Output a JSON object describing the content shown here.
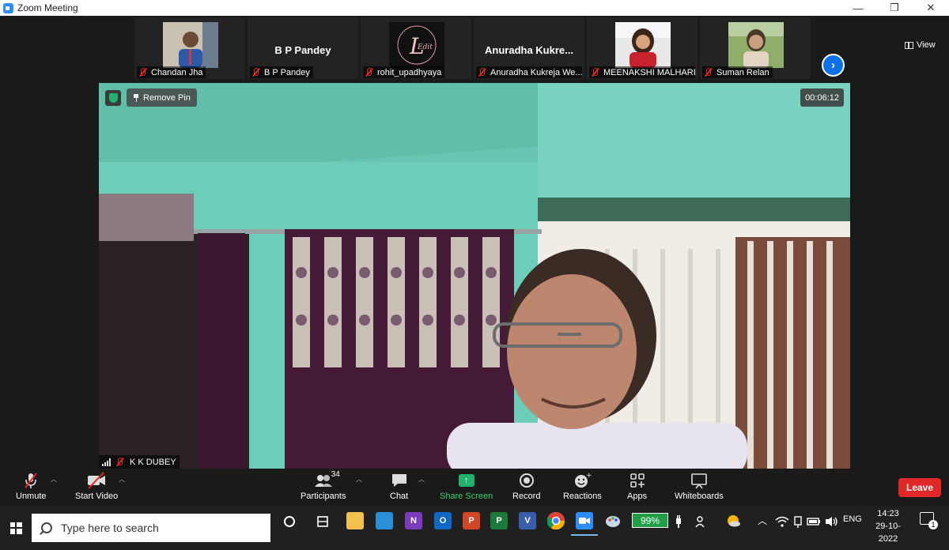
{
  "window": {
    "title": "Zoom Meeting",
    "controls": [
      "—",
      "❐",
      "✕"
    ]
  },
  "thumbnails": [
    {
      "label": "Chandan Jha",
      "big_name": "",
      "has_video": true
    },
    {
      "label": "B P Pandey",
      "big_name": "B P Pandey",
      "has_video": false
    },
    {
      "label": "rohit_upadhyaya",
      "big_name": "",
      "has_video": true
    },
    {
      "label": "Anuradha Kukreja We...",
      "big_name": "Anuradha  Kukre...",
      "has_video": false
    },
    {
      "label": "MEENAKSHI MALHARI",
      "big_name": "",
      "has_video": true
    },
    {
      "label": "Suman Relan",
      "big_name": "",
      "has_video": true
    }
  ],
  "view_button": {
    "label": "View"
  },
  "main_video": {
    "remove_pin_label": "Remove Pin",
    "timer": "00:06:12",
    "speaker_name": "K K DUBEY"
  },
  "controls": {
    "unmute": "Unmute",
    "start_video": "Start Video",
    "participants": "Participants",
    "participants_count": "34",
    "chat": "Chat",
    "share_screen": "Share Screen",
    "record": "Record",
    "reactions": "Reactions",
    "apps": "Apps",
    "whiteboards": "Whiteboards",
    "leave": "Leave"
  },
  "taskbar": {
    "search_placeholder": "Type here to search",
    "battery": "99%",
    "language": "ENG",
    "time": "14:23",
    "date": "29-10-2022"
  },
  "colors": {
    "zoom_blue": "#0e71eb",
    "leave_red": "#e02828",
    "share_green": "#21b26f",
    "wall_green": "#6fd0bd"
  }
}
